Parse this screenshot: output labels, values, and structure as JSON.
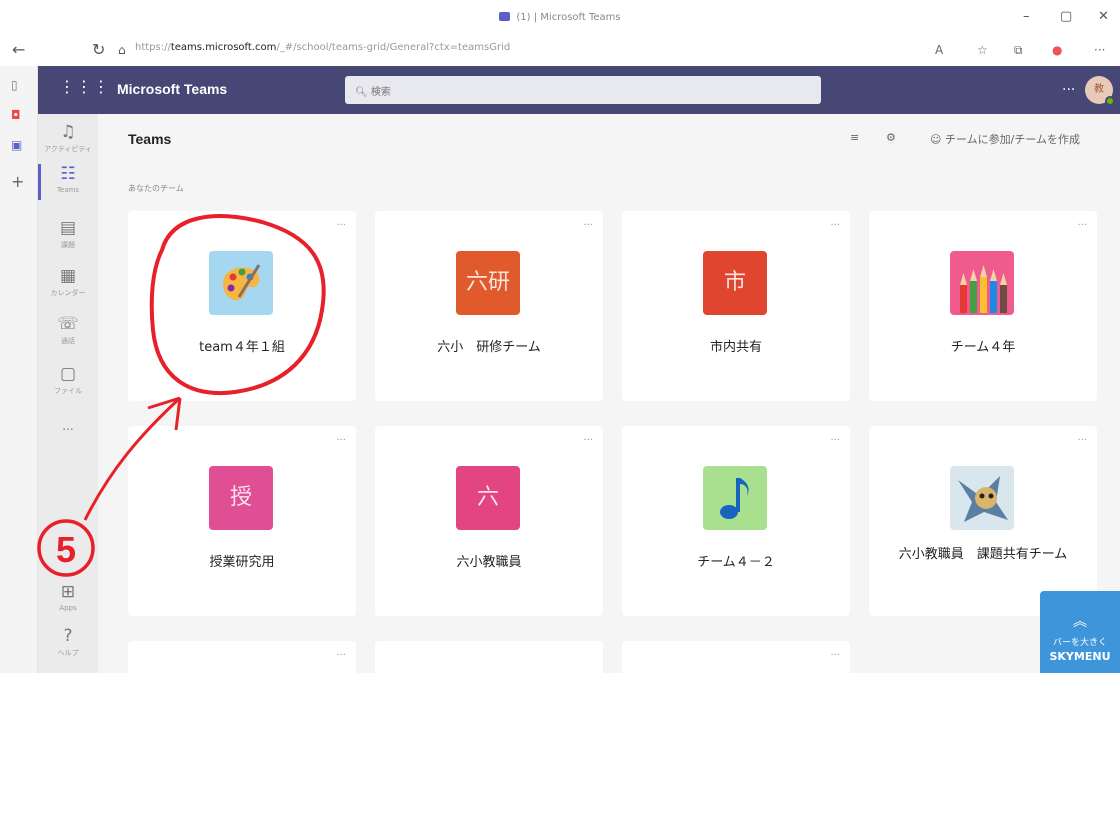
{
  "window": {
    "title": "(1) | Microsoft Teams",
    "minimize_icon": "minimize-icon",
    "maximize_icon": "maximize-icon",
    "close_icon": "close-icon"
  },
  "address_bar": {
    "url_prefix": "https://",
    "url_host": "teams.microsoft.com",
    "url_path": "/_#/school/teams-grid/General?ctx=teamsGrid"
  },
  "app_header": {
    "name": "Microsoft Teams",
    "search_placeholder": "検索",
    "more_label": "...",
    "avatar_initial": "教"
  },
  "rail": {
    "items": [
      {
        "label": "アクティビティ",
        "icon": "bell-icon"
      },
      {
        "label": "Teams",
        "icon": "teams-icon"
      },
      {
        "label": "課題",
        "icon": "assignments-icon"
      },
      {
        "label": "カレンダー",
        "icon": "calendar-icon"
      },
      {
        "label": "通話",
        "icon": "phone-icon"
      },
      {
        "label": "ファイル",
        "icon": "file-icon"
      }
    ],
    "more_label": "...",
    "apps_label": "Apps",
    "help_label": "ヘルプ"
  },
  "main": {
    "title": "Teams",
    "join_create_label": "チームに参加/チームを作成",
    "section_label": "あなたのチーム",
    "teams": [
      {
        "name": "team４年１組",
        "tile_text": "",
        "tile_color": "#a5d8f0",
        "icon": "palette-icon"
      },
      {
        "name": "六小　研修チーム",
        "tile_text": "六研",
        "tile_color": "#e05a2b"
      },
      {
        "name": "市内共有",
        "tile_text": "市",
        "tile_color": "#e0462f"
      },
      {
        "name": "チーム４年",
        "tile_text": "",
        "tile_color": "#ef5b8c",
        "icon": "pencils-icon"
      },
      {
        "name": "授業研究用",
        "tile_text": "授",
        "tile_color": "#e04e93"
      },
      {
        "name": "六小教職員",
        "tile_text": "六",
        "tile_color": "#e2457f"
      },
      {
        "name": "チーム４－２",
        "tile_text": "",
        "tile_color": "#a9e08f",
        "icon": "music-note-icon"
      },
      {
        "name": "六小教職員　課題共有チーム",
        "tile_text": "",
        "tile_color": "#d9e6ee",
        "icon": "character-icon"
      }
    ],
    "more_label": "..."
  },
  "annotation": {
    "label": "⑤",
    "color": "#e8202a"
  },
  "skymenu": {
    "line1": "バーを大きく",
    "line2": "SKYMENU"
  },
  "colors": {
    "header": "#464775",
    "accent": "#5b5fc7",
    "rail": "#ebebeb",
    "main_bg": "#f5f5f5"
  }
}
